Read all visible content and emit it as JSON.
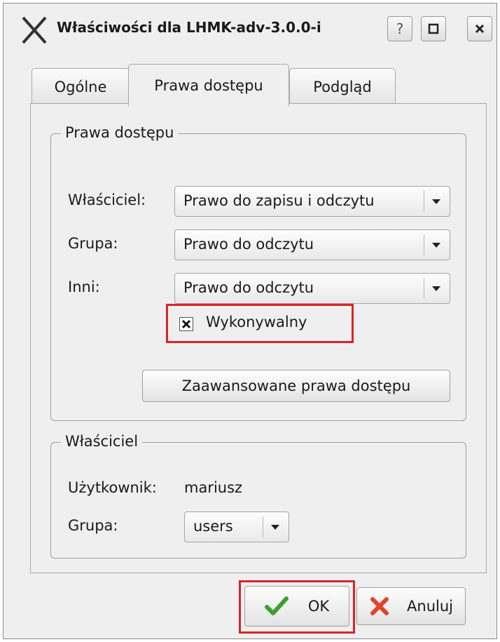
{
  "window": {
    "title": "Właściwości dla LHMK-adv-3.0.0-i",
    "help_label": "?",
    "app_icon": "x-icon"
  },
  "tabs": [
    {
      "label": "Ogólne",
      "mnemonic_index": 2,
      "active": false
    },
    {
      "label": "Prawa dostępu",
      "mnemonic_index": 0,
      "active": true
    },
    {
      "label": "Podgląd",
      "mnemonic_index": 4,
      "active": false
    }
  ],
  "permissions": {
    "group_title": "Prawa dostępu",
    "owner": {
      "label": "Właściciel:",
      "value": "Prawo do zapisu i odczytu"
    },
    "group": {
      "label": "Grupa:",
      "value": "Prawo do odczytu"
    },
    "others": {
      "label": "Inni:",
      "value": "Prawo do odczytu"
    },
    "executable": {
      "label": "Wykonywalny",
      "checked": true
    },
    "advanced_button": "Zaawansowane prawa dostępu"
  },
  "ownership": {
    "group_title": "Właściciel",
    "user_label": "Użytkownik:",
    "user_value": "mariusz",
    "group_label": "Grupa:",
    "group_value": "users"
  },
  "buttons": {
    "ok": "OK",
    "cancel": "Anuluj"
  },
  "colors": {
    "highlight": "#d9252a",
    "ok_check": "#3aa02e",
    "cancel_x": "#e0452a"
  }
}
